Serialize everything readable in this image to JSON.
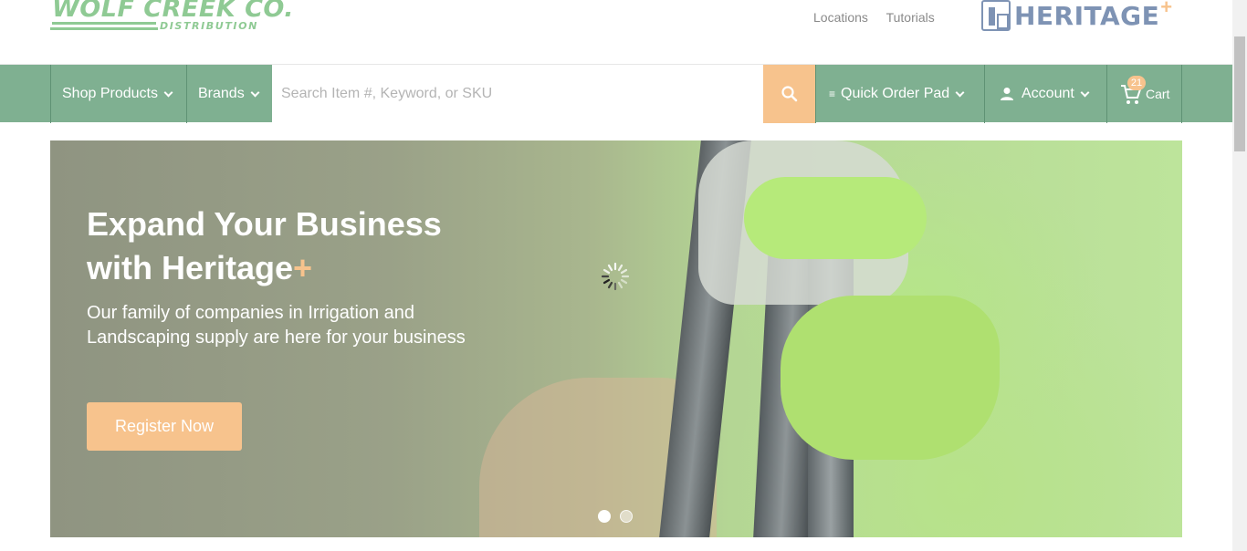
{
  "header": {
    "logo_main": "WOLF CREEK CO.",
    "logo_sub": "DISTRIBUTION",
    "links": [
      "Locations",
      "Tutorials"
    ],
    "partner_logo": "HERITAGE",
    "partner_plus": "+"
  },
  "nav": {
    "shop_products": "Shop Products",
    "brands": "Brands",
    "search_placeholder": "Search Item #, Keyword, or SKU",
    "quick_order": "Quick Order Pad",
    "account": "Account",
    "cart_label": "Cart",
    "cart_count": "21"
  },
  "hero": {
    "title_line1": "Expand Your Business",
    "title_line2": "with Heritage",
    "title_plus": "+",
    "subtitle": "Our family of companies in Irrigation and Landscaping supply are here for your business",
    "cta": "Register Now",
    "slides": 2,
    "active_slide": 1
  },
  "colors": {
    "nav_green": "#7fb091",
    "accent_orange": "#f7c38d",
    "logo_green": "#8fca94",
    "heritage_blue": "#7e93b4"
  }
}
